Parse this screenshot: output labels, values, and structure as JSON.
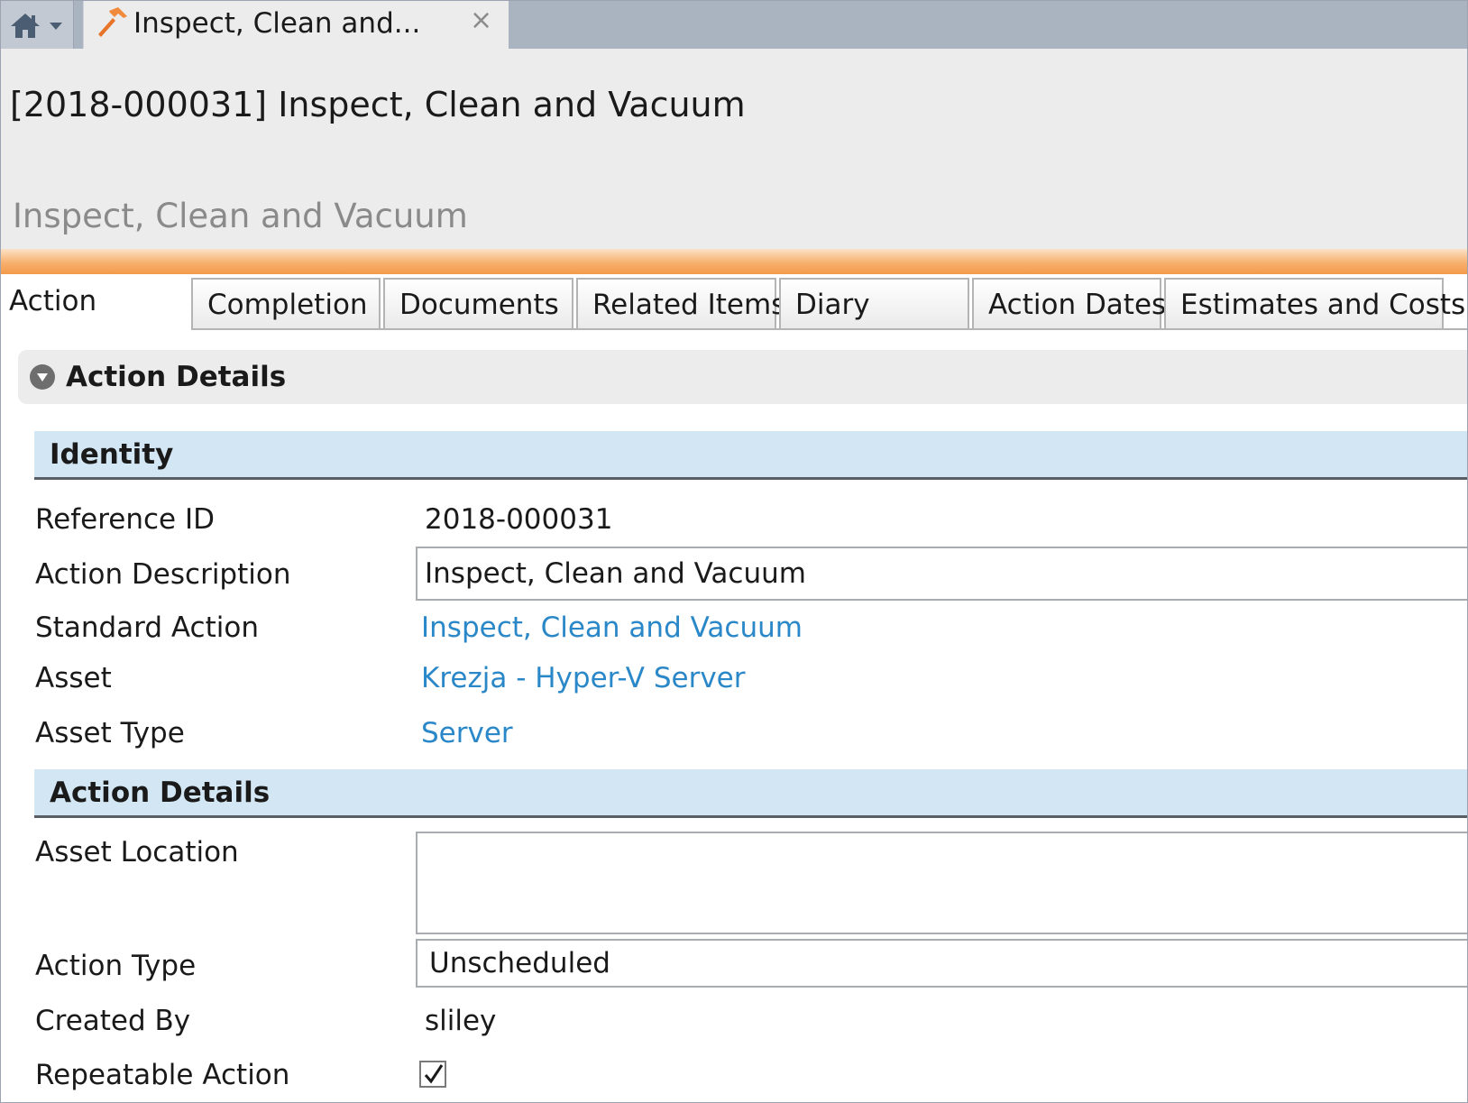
{
  "tabstrip": {
    "home_icon": "home-icon",
    "document_tab": {
      "title": "Inspect, Clean and...",
      "icon": "hammer-icon",
      "close_glyph": "×"
    }
  },
  "header": {
    "record_title": "[2018-000031] Inspect, Clean and Vacuum",
    "record_subtitle": "Inspect, Clean and Vacuum"
  },
  "section_tabs": [
    {
      "label": "Action",
      "active": true
    },
    {
      "label": "Completion",
      "active": false
    },
    {
      "label": "Documents",
      "active": false
    },
    {
      "label": "Related Items",
      "active": false
    },
    {
      "label": "Diary",
      "active": false
    },
    {
      "label": "Action Dates",
      "active": false
    },
    {
      "label": "Estimates and Costs",
      "active": false
    }
  ],
  "collapsible": {
    "title": "Action Details",
    "icon": "collapse-toggle-icon"
  },
  "identity": {
    "header": "Identity",
    "reference_id": {
      "label": "Reference ID",
      "value": "2018-000031"
    },
    "action_description": {
      "label": "Action Description",
      "value": "Inspect, Clean and Vacuum"
    },
    "standard_action": {
      "label": "Standard Action",
      "value": "Inspect, Clean and Vacuum"
    },
    "asset": {
      "label": "Asset",
      "value": "Krezja - Hyper-V Server"
    },
    "asset_type": {
      "label": "Asset Type",
      "value": "Server"
    }
  },
  "action_details": {
    "header": "Action Details",
    "asset_location": {
      "label": "Asset Location",
      "value": ""
    },
    "action_type": {
      "label": "Action Type",
      "value": "Unscheduled"
    },
    "created_by": {
      "label": "Created By",
      "value": "sliley"
    },
    "repeatable_action": {
      "label": "Repeatable Action",
      "checked": true
    }
  },
  "colors": {
    "accent_orange": "#f39a4a",
    "link_blue": "#2b88c8",
    "group_header_bg": "#d3e6f3",
    "tabstrip_bg": "#aab3c0"
  }
}
